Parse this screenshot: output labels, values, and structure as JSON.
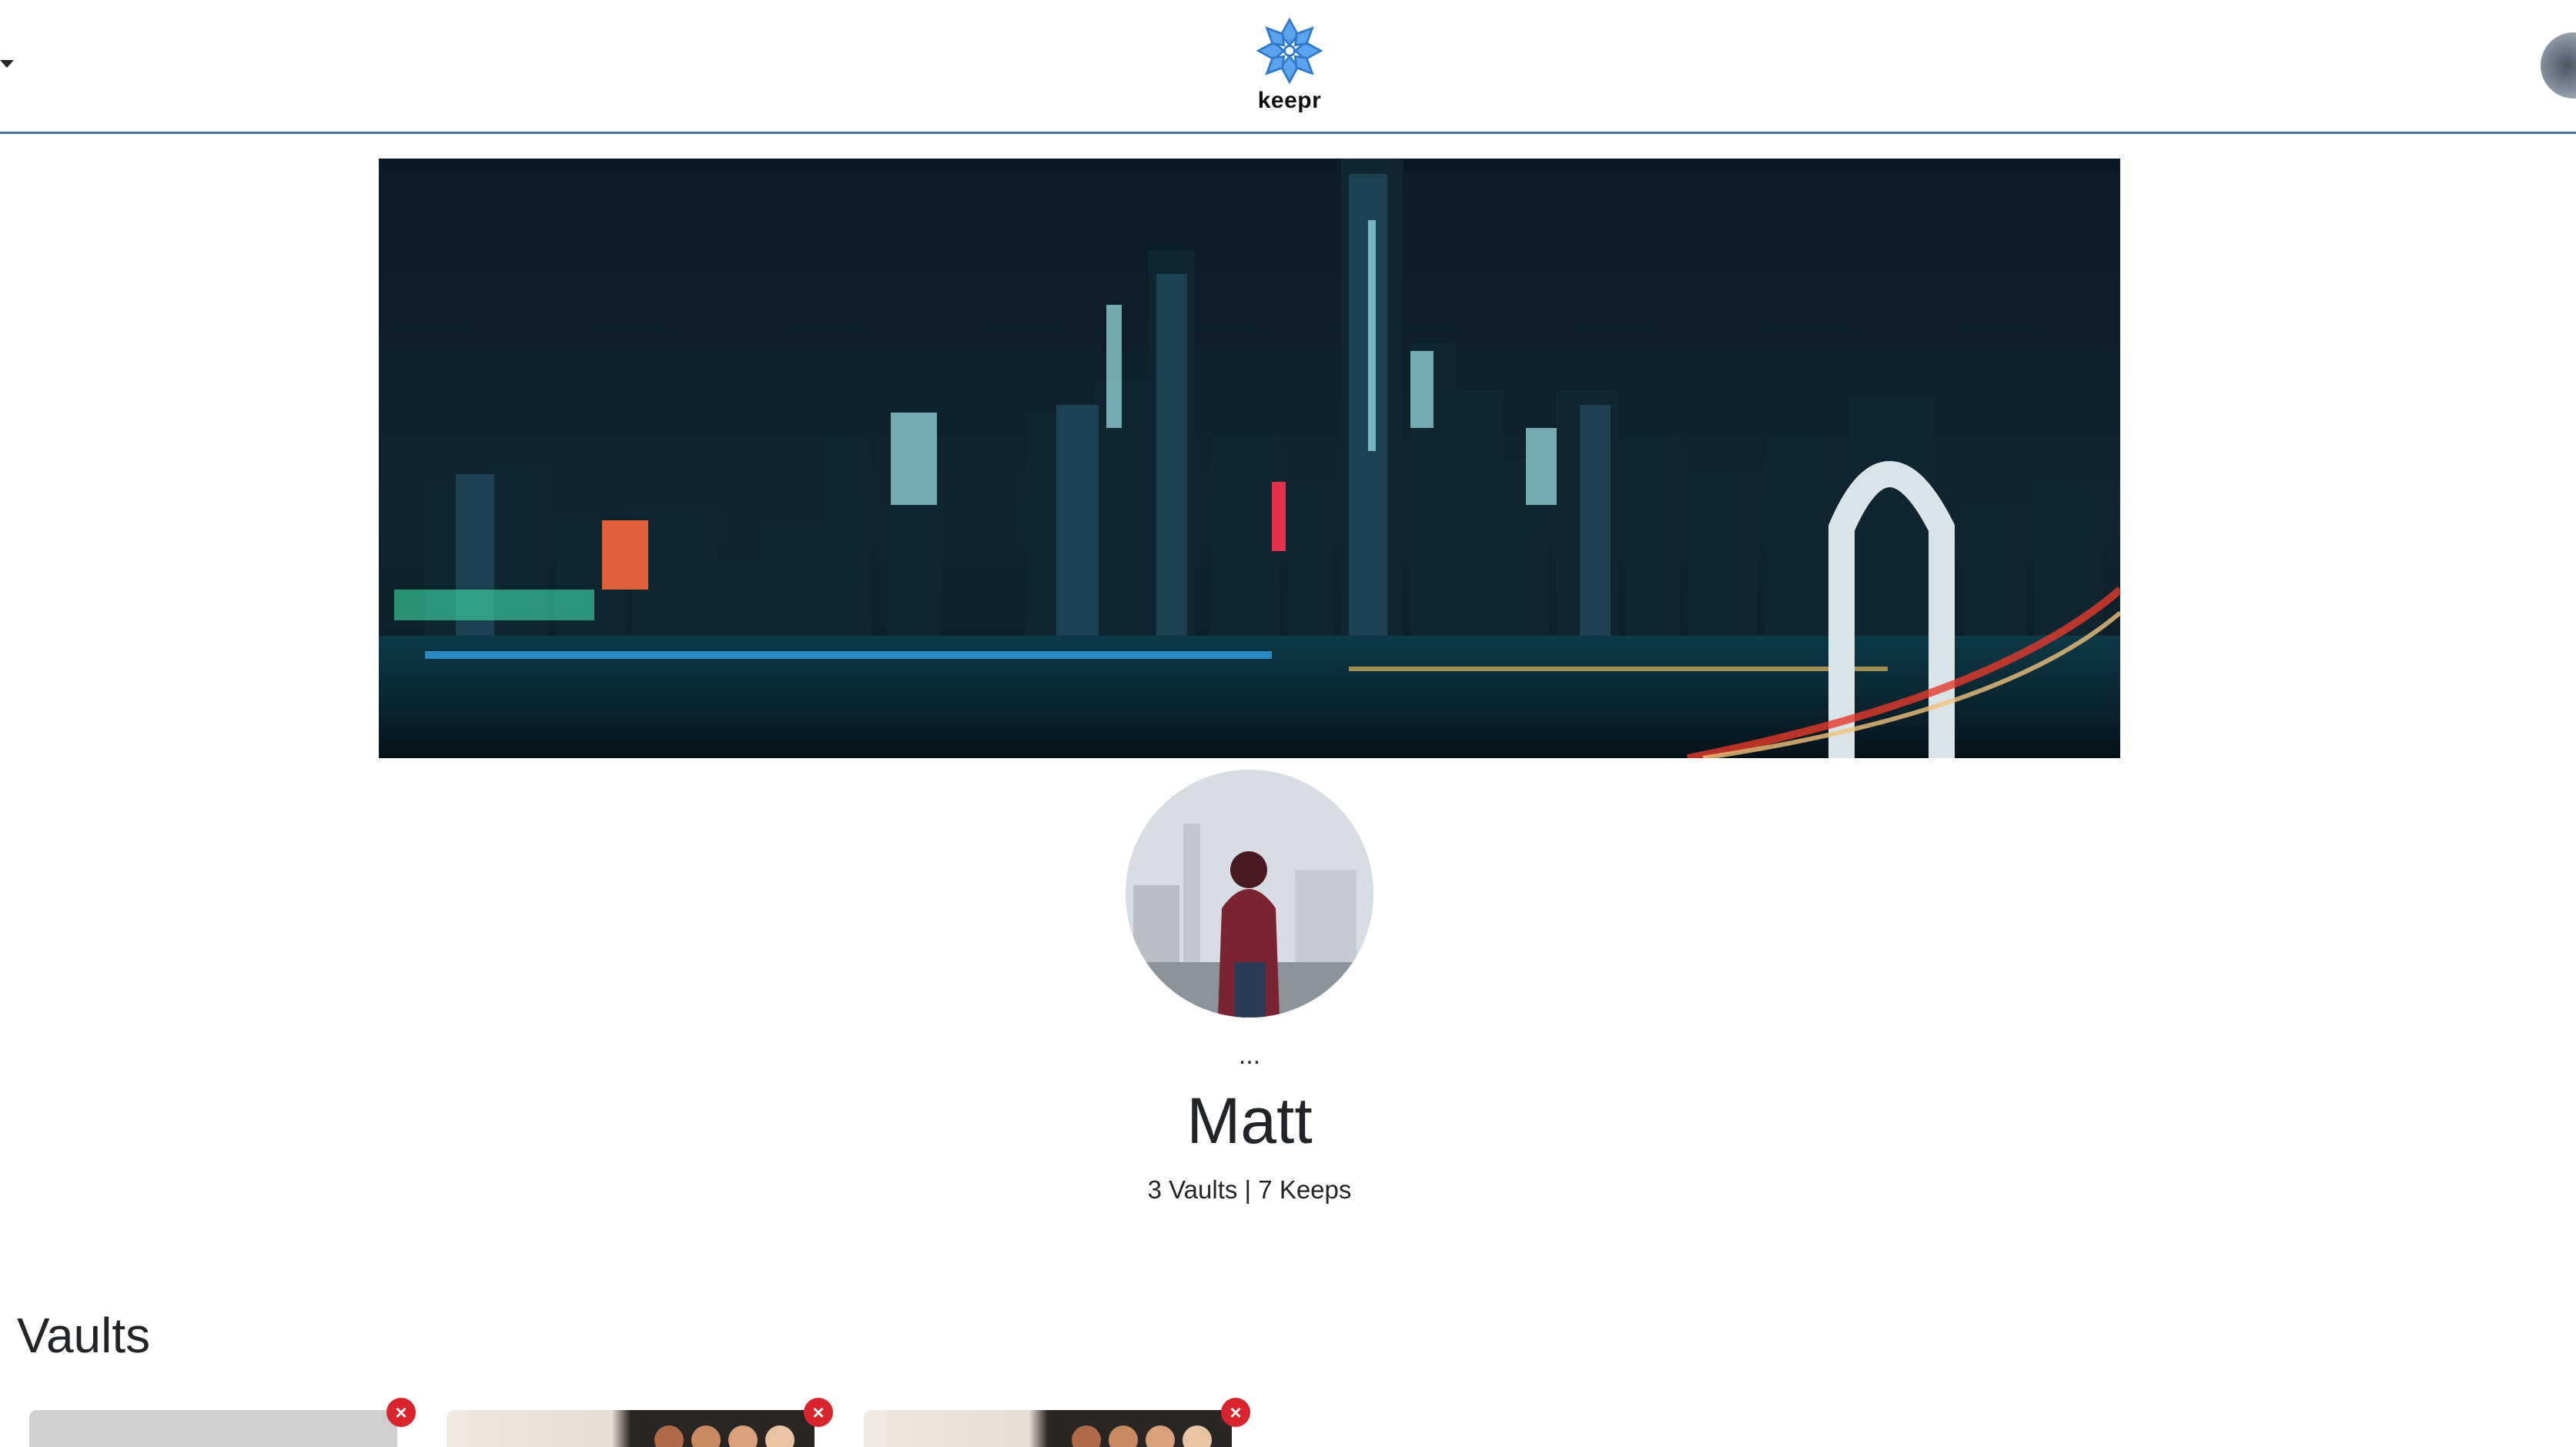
{
  "navbar": {
    "brand_name": "keepr",
    "brand_icon": "snowflake-logo-icon",
    "menu_toggle_icon": "caret-down-icon",
    "avatar": "user-avatar"
  },
  "profile": {
    "ellipsis": "...",
    "name": "Matt",
    "stats": "3 Vaults | 7 Keeps"
  },
  "vaults": {
    "heading": "Vaults",
    "delete_icon": "close-icon",
    "delete_glyph": "×",
    "items": [
      {
        "style": "plain-gray"
      },
      {
        "style": "makeup-palette"
      },
      {
        "style": "makeup-palette"
      }
    ]
  },
  "colors": {
    "navbar_border": "#4a6fa5",
    "brand_blue": "#3b8de0",
    "delete_red": "#d9232d"
  }
}
